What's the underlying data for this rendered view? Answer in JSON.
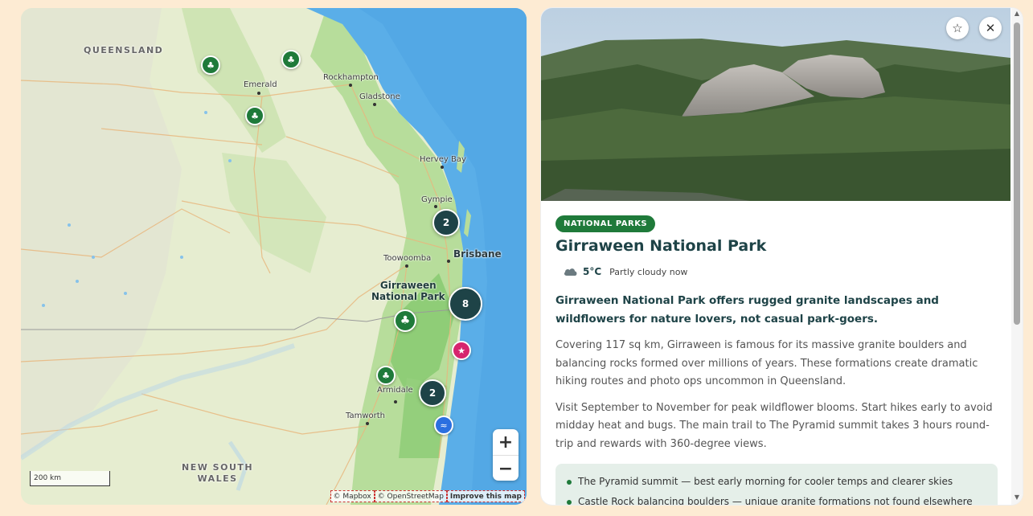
{
  "map": {
    "places": {
      "queensland": "QUEENSLAND",
      "emerald": "Emerald",
      "rockhampton": "Rockhampton",
      "gladstone": "Gladstone",
      "hervey_bay": "Hervey Bay",
      "gympie": "Gympie",
      "brisbane": "Brisbane",
      "toowoomba": "Toowoomba",
      "girraween_line1": "Girraween",
      "girraween_line2": "National Park",
      "armidale": "Armidale",
      "tamworth": "Tamworth",
      "nsw_line1": "NEW SOUTH",
      "nsw_line2": "WALES"
    },
    "clusters": [
      "2",
      "8",
      "2"
    ],
    "zoom_in": "+",
    "zoom_out": "−",
    "scale": "200 km",
    "attribution": {
      "mapbox": "© Mapbox",
      "osm": "© OpenStreetMap",
      "improve": "Improve this map"
    },
    "colors": {
      "water": "#5aaee8",
      "land": "#e6edd0",
      "green": "#a9d88f",
      "park_pin": "#1f7a3a",
      "cluster": "#1e4347",
      "star_pin": "#d6246e",
      "wave_pin": "#2b6fe0"
    }
  },
  "panel": {
    "badge": "NATIONAL PARKS",
    "title": "Girraween National Park",
    "weather": {
      "temp": "5°C",
      "desc": "Partly cloudy now",
      "icon": "cloud-icon"
    },
    "lead": "Girraween National Park offers rugged granite landscapes and wildflowers for nature lovers, not casual park-goers.",
    "paragraphs": [
      "Covering 117 sq km, Girraween is famous for its massive granite boulders and balancing rocks formed over millions of years. These formations create dramatic hiking routes and photo ops uncommon in Queensland.",
      "Visit September to November for peak wildflower blooms. Start hikes early to avoid midday heat and bugs. The main trail to The Pyramid summit takes 3 hours round-trip and rewards with 360-degree views."
    ],
    "highlights": [
      "The Pyramid summit — best early morning for cooler temps and clearer skies",
      "Castle Rock balancing boulders — unique granite formations not found elsewhere"
    ],
    "favorite_icon": "☆",
    "close_icon": "✕"
  }
}
